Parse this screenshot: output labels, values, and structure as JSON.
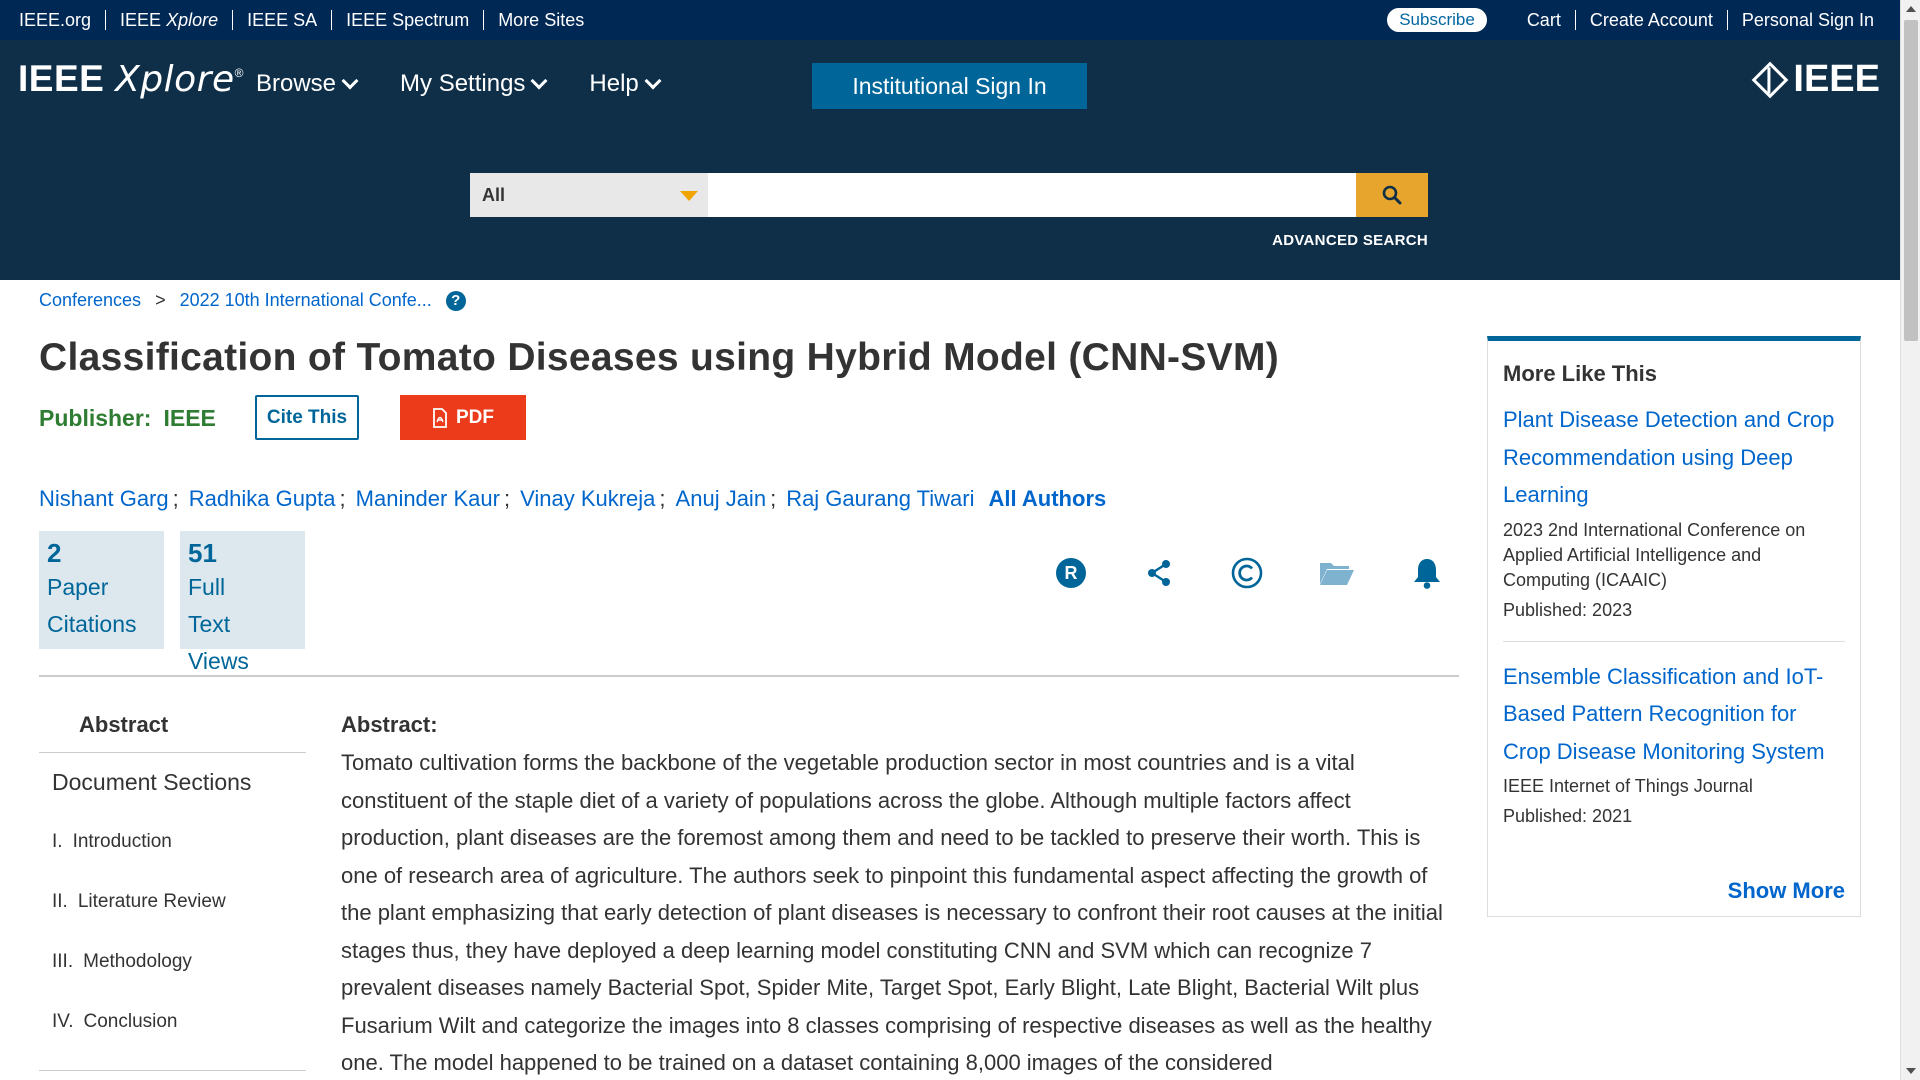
{
  "topbar": {
    "sites": [
      {
        "label": "IEEE.org"
      },
      {
        "label_a": "IEEE ",
        "label_b": "Xplore"
      },
      {
        "label": "IEEE SA"
      },
      {
        "label": "IEEE Spectrum"
      },
      {
        "label": "More Sites"
      }
    ],
    "subscribe": "Subscribe",
    "links": [
      "Cart",
      "Create Account",
      "Personal Sign In"
    ]
  },
  "nav": {
    "logo_a": "IEEE",
    "logo_b": "Xplore",
    "logo_reg": "®",
    "menu": [
      "Browse",
      "My Settings",
      "Help"
    ],
    "institutional_signin": "Institutional Sign In",
    "ieee_logo": "IEEE"
  },
  "search": {
    "scope": "All",
    "query": "",
    "advanced": "ADVANCED SEARCH"
  },
  "breadcrumb": {
    "items": [
      "Conferences",
      "2022 10th International Confe..."
    ],
    "separator": ">",
    "help": "?"
  },
  "article": {
    "title": "Classification of Tomato Diseases using Hybrid Model (CNN-SVM)",
    "publisher_label": "Publisher:",
    "publisher": "IEEE",
    "cite_button": "Cite This",
    "pdf_button": "PDF",
    "authors": [
      "Nishant Garg",
      "Radhika Gupta",
      "Maninder Kaur",
      "Vinay Kukreja",
      "Anuj Jain",
      "Raj Gaurang Tiwari"
    ],
    "author_separator": ";",
    "all_authors": "All Authors",
    "metrics": [
      {
        "value": "2",
        "line1": "Paper",
        "line2": "Citations"
      },
      {
        "value": "51",
        "line1": "Full",
        "line2": "Text Views"
      }
    ],
    "actions": [
      "rights-icon",
      "share-icon",
      "copyright-icon",
      "folder-icon",
      "bell-icon"
    ],
    "accent_color": "#006699"
  },
  "docnav": {
    "active": "Abstract",
    "sections_heading": "Document Sections",
    "sections": [
      {
        "num": "I.",
        "label": "Introduction"
      },
      {
        "num": "II.",
        "label": "Literature Review"
      },
      {
        "num": "III.",
        "label": "Methodology"
      },
      {
        "num": "IV.",
        "label": "Conclusion"
      }
    ]
  },
  "abstract": {
    "heading": "Abstract:",
    "text": "Tomato cultivation forms the backbone of the vegetable production sector in most countries and is a vital constituent of the staple diet of a variety of populations across the globe. Although multiple factors affect production, plant diseases are the foremost among them and need to be tackled to preserve their worth. This is one of research area of agriculture. The authors seek to pinpoint this fundamental aspect affecting the growth of the plant emphasizing that early detection of plant diseases is necessary to confront their root causes at the initial stages thus, they have deployed a deep learning model constituting CNN and SVM which can recognize 7 prevalent diseases namely Bacterial Spot, Spider Mite, Target Spot, Early Blight, Late Blight, Bacterial Wilt plus Fusarium Wilt and categorize the images into 8 classes comprising of respective diseases as well as the healthy one. The model happened to be trained on a dataset containing 8,000 images of the considered"
  },
  "sidebar": {
    "heading": "More Like This",
    "items": [
      {
        "title": "Plant Disease Detection and Crop Recommendation using Deep Learning",
        "venue": "2023 2nd International Conference on Applied Artificial Intelligence and Computing (ICAAIC)",
        "published": "Published: 2023"
      },
      {
        "title": "Ensemble Classification and IoT-Based Pattern Recognition for Crop Disease Monitoring System",
        "venue": "IEEE Internet of Things Journal",
        "published": "Published: 2021"
      }
    ],
    "show_more": "Show More"
  }
}
